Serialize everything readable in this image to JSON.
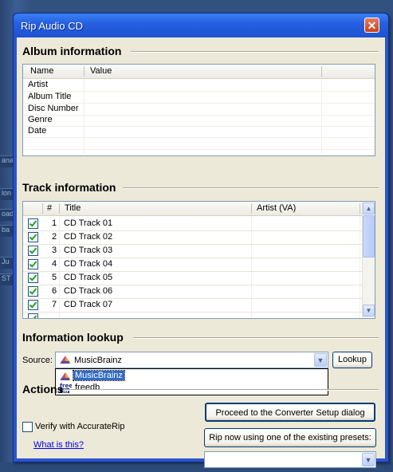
{
  "window": {
    "title": "Rip Audio CD"
  },
  "background": {
    "fragments": [
      "ana",
      "lon",
      "oad",
      "ba",
      "Ju",
      "ST"
    ]
  },
  "album": {
    "section_title": "Album information",
    "columns": [
      "Name",
      "Value"
    ],
    "rows": [
      {
        "name": "Artist",
        "value": ""
      },
      {
        "name": "Album Title",
        "value": ""
      },
      {
        "name": "Disc Number",
        "value": ""
      },
      {
        "name": "Genre",
        "value": ""
      },
      {
        "name": "Date",
        "value": ""
      }
    ]
  },
  "tracks": {
    "section_title": "Track information",
    "columns": [
      "#",
      "Title",
      "Artist (VA)"
    ],
    "rows": [
      {
        "checked": true,
        "num": "1",
        "title": "CD Track 01",
        "artist": ""
      },
      {
        "checked": true,
        "num": "2",
        "title": "CD Track 02",
        "artist": ""
      },
      {
        "checked": true,
        "num": "3",
        "title": "CD Track 03",
        "artist": ""
      },
      {
        "checked": true,
        "num": "4",
        "title": "CD Track 04",
        "artist": ""
      },
      {
        "checked": true,
        "num": "5",
        "title": "CD Track 05",
        "artist": ""
      },
      {
        "checked": true,
        "num": "6",
        "title": "CD Track 06",
        "artist": ""
      },
      {
        "checked": true,
        "num": "7",
        "title": "CD Track 07",
        "artist": ""
      }
    ]
  },
  "lookup": {
    "section_title": "Information lookup",
    "source_label": "Source:",
    "source_value": "MusicBrainz",
    "lookup_button": "Lookup",
    "options": [
      {
        "label": "MusicBrainz",
        "icon": "musicbrainz-icon",
        "selected": true
      },
      {
        "label": "freedb",
        "icon": "freedb-icon",
        "selected": false
      }
    ]
  },
  "actions": {
    "section_title": "Actions",
    "verify_label": "Verify with AccurateRip",
    "verify_checked": false,
    "what_link": "What is this?",
    "proceed_button": "Proceed to the Converter Setup dialog",
    "rip_button": "Rip now using one of the existing presets:",
    "preset_value": ""
  },
  "colors": {
    "accent": "#316ac5",
    "title_bar": "#2660e0",
    "check": "#21a121"
  }
}
